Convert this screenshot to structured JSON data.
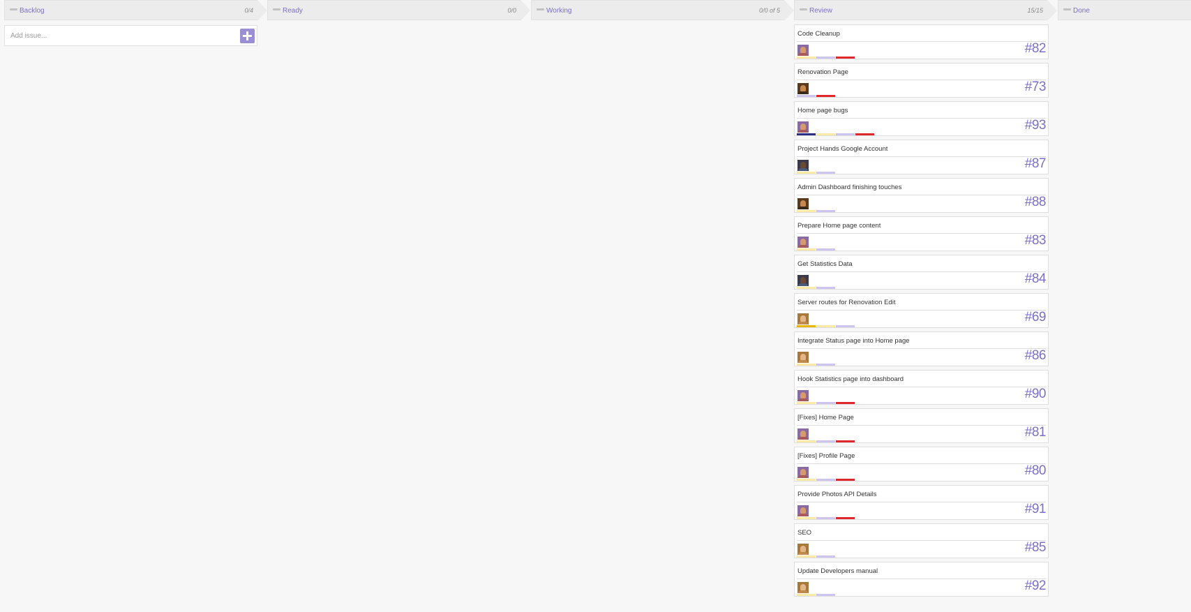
{
  "columns": [
    {
      "title": "Backlog",
      "count": "0/4"
    },
    {
      "title": "Ready",
      "count": "0/0"
    },
    {
      "title": "Working",
      "count": "0/0 of 5"
    },
    {
      "title": "Review",
      "count": "15/15"
    },
    {
      "title": "Done",
      "count": ""
    }
  ],
  "add_issue": {
    "placeholder": "Add issue..."
  },
  "label_colors": {
    "yellow": "#fce9a6",
    "lavender": "#cdc5f0",
    "red": "#e0282c",
    "navy": "#2b2f80",
    "gold": "#e8b400"
  },
  "avatar_styles": {
    "a": {
      "hair": "#8a6aa6",
      "face": "#d79a6a",
      "body": "#a85a5a"
    },
    "b": {
      "hair": "#5a3a1c",
      "face": "#c8874e",
      "body": "#3a2a1a"
    },
    "c": {
      "hair": "#3a3a4a",
      "face": "#6b4a35",
      "body": "#4a5a7a"
    },
    "d": {
      "hair": "#a8783a",
      "face": "#e2b58a",
      "body": "#c28a4a"
    }
  },
  "cards": [
    {
      "title": "Code Cleanup",
      "number": "#82",
      "avatar": "a",
      "labels": [
        "yellow",
        "lavender",
        "red"
      ]
    },
    {
      "title": "Renovation Page",
      "number": "#73",
      "avatar": "b",
      "labels": [
        "lavender",
        "red"
      ]
    },
    {
      "title": "Home page bugs",
      "number": "#93",
      "avatar": "a",
      "labels": [
        "navy",
        "yellow",
        "lavender",
        "red"
      ]
    },
    {
      "title": "Project Hands Google Account",
      "number": "#87",
      "avatar": "c",
      "labels": [
        "yellow",
        "lavender"
      ]
    },
    {
      "title": "Admin Dashboard finishing touches",
      "number": "#88",
      "avatar": "b",
      "labels": [
        "yellow",
        "lavender"
      ]
    },
    {
      "title": "Prepare Home page content",
      "number": "#83",
      "avatar": "a",
      "labels": [
        "yellow",
        "lavender"
      ]
    },
    {
      "title": "Get Statistics Data",
      "number": "#84",
      "avatar": "c",
      "labels": [
        "yellow",
        "lavender"
      ]
    },
    {
      "title": "Server routes for Renovation Edit",
      "number": "#69",
      "avatar": "d",
      "labels": [
        "gold",
        "yellow",
        "lavender"
      ]
    },
    {
      "title": "Integrate Status page into Home page",
      "number": "#86",
      "avatar": "d",
      "labels": [
        "yellow",
        "lavender"
      ]
    },
    {
      "title": "Hook Statistics page into dashboard",
      "number": "#90",
      "avatar": "a",
      "labels": [
        "yellow",
        "lavender",
        "red"
      ]
    },
    {
      "title": "[Fixes] Home Page",
      "number": "#81",
      "avatar": "a",
      "labels": [
        "yellow",
        "lavender",
        "red"
      ]
    },
    {
      "title": "[Fixes] Profile Page",
      "number": "#80",
      "avatar": "a",
      "labels": [
        "yellow",
        "lavender",
        "red"
      ]
    },
    {
      "title": "Provide Photos API Details",
      "number": "#91",
      "avatar": "a",
      "labels": [
        "yellow",
        "lavender",
        "red"
      ]
    },
    {
      "title": "SEO",
      "number": "#85",
      "avatar": "d",
      "labels": [
        "yellow",
        "lavender"
      ]
    },
    {
      "title": "Update Developers manual",
      "number": "#92",
      "avatar": "d",
      "labels": [
        "yellow",
        "lavender"
      ]
    }
  ]
}
